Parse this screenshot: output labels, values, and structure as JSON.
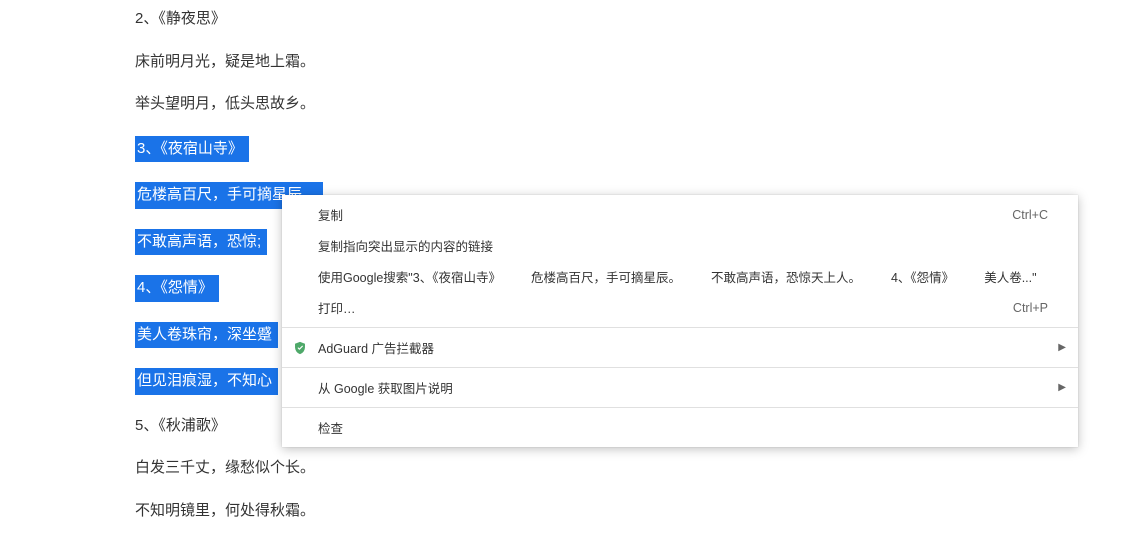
{
  "content": {
    "heading2": "2、《静夜思》",
    "line2a": "床前明月光，疑是地上霜。",
    "line2b": "举头望明月，低头思故乡。",
    "heading3": "3、《夜宿山寺》",
    "line3a": "危楼高百尺，手可摘星辰。",
    "line3b_partial": "不敢高声语，恐惊;",
    "heading4": "4、《怨情》",
    "line4a_partial": "美人卷珠帘，深坐蹙",
    "line4b_partial": "但见泪痕湿，不知心",
    "heading5": "5、《秋浦歌》",
    "line5a": "白发三千丈，缘愁似个长。",
    "line5b": "不知明镜里，何处得秋霜。"
  },
  "menu": {
    "copy": "复制",
    "copy_shortcut": "Ctrl+C",
    "copy_link": "复制指向突出显示的内容的链接",
    "search_prefix": "使用Google搜索\"3、《夜宿山寺》",
    "search_part2": "危楼高百尺，手可摘星辰。",
    "search_part3": "不敢高声语，恐惊天上人。",
    "search_part4": "4、《怨情》",
    "search_part5": "美人卷...\"",
    "print": "打印…",
    "print_shortcut": "Ctrl+P",
    "adguard": "AdGuard 广告拦截器",
    "image_desc": "从 Google 获取图片说明",
    "inspect": "检查"
  },
  "colors": {
    "selection": "#1a73e8",
    "shield": "#4ea869"
  }
}
